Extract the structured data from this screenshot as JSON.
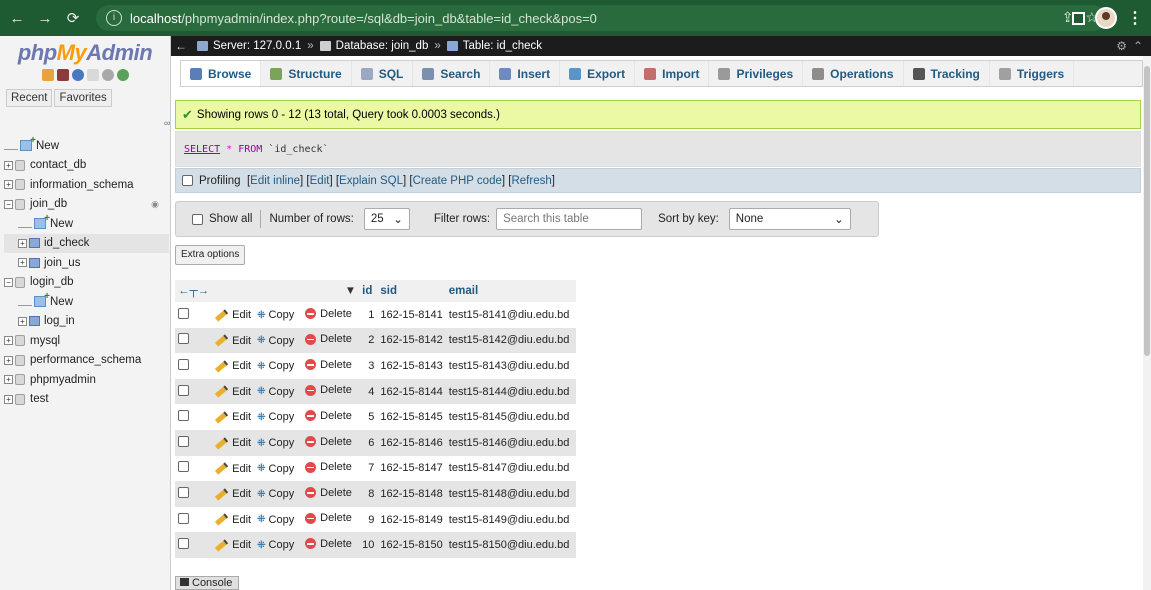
{
  "browser": {
    "url_host": "localhost",
    "url_path": "/phpmyadmin/index.php?route=/sql&db=join_db&table=id_check&pos=0"
  },
  "nav": {
    "logo_php": "php",
    "logo_my": "My",
    "logo_admin": "Admin",
    "tabs": [
      "Recent",
      "Favorites"
    ],
    "tree": [
      {
        "label": "New",
        "type": "new",
        "level": 0
      },
      {
        "label": "contact_db",
        "type": "db",
        "level": 0
      },
      {
        "label": "information_schema",
        "type": "db",
        "level": 0
      },
      {
        "label": "join_db",
        "type": "db",
        "level": 0,
        "expanded": true
      },
      {
        "label": "New",
        "type": "new",
        "level": 1
      },
      {
        "label": "id_check",
        "type": "table",
        "level": 1,
        "selected": true
      },
      {
        "label": "join_us",
        "type": "table",
        "level": 1
      },
      {
        "label": "login_db",
        "type": "db",
        "level": 0,
        "expanded": true
      },
      {
        "label": "New",
        "type": "new",
        "level": 1
      },
      {
        "label": "log_in",
        "type": "table",
        "level": 1
      },
      {
        "label": "mysql",
        "type": "db",
        "level": 0
      },
      {
        "label": "performance_schema",
        "type": "db",
        "level": 0
      },
      {
        "label": "phpmyadmin",
        "type": "db",
        "level": 0
      },
      {
        "label": "test",
        "type": "db",
        "level": 0
      }
    ]
  },
  "breadcrumb": {
    "server": "Server: 127.0.0.1",
    "database": "Database: join_db",
    "table": "Table: id_check"
  },
  "menu": [
    {
      "label": "Browse",
      "icon": "browse-icon",
      "color": "#5a7fb6",
      "active": true
    },
    {
      "label": "Structure",
      "icon": "structure-icon",
      "color": "#7aa45a"
    },
    {
      "label": "SQL",
      "icon": "sql-icon",
      "color": "#9aa9c1"
    },
    {
      "label": "Search",
      "icon": "search-icon",
      "color": "#7b8fb0"
    },
    {
      "label": "Insert",
      "icon": "insert-icon",
      "color": "#6f8ac0"
    },
    {
      "label": "Export",
      "icon": "export-icon",
      "color": "#5d94c8"
    },
    {
      "label": "Import",
      "icon": "import-icon",
      "color": "#c46d6d"
    },
    {
      "label": "Privileges",
      "icon": "privileges-icon",
      "color": "#9a9a9a"
    },
    {
      "label": "Operations",
      "icon": "operations-icon",
      "color": "#8d8d8d"
    },
    {
      "label": "Tracking",
      "icon": "tracking-icon",
      "color": "#555555"
    },
    {
      "label": "Triggers",
      "icon": "triggers-icon",
      "color": "#a0a0a0"
    }
  ],
  "message": {
    "success": "Showing rows 0 - 12 (13 total, Query took 0.0003 seconds.)"
  },
  "sql": {
    "select": "SELECT",
    "star": "*",
    "from": "FROM",
    "table": "`id_check`"
  },
  "profiling": {
    "label": "Profiling",
    "links": [
      "Edit inline",
      "Edit",
      "Explain SQL",
      "Create PHP code",
      "Refresh"
    ]
  },
  "controls": {
    "show_all": "Show all",
    "number_of_rows_label": "Number of rows:",
    "number_of_rows_value": "25",
    "filter_label": "Filter rows:",
    "filter_placeholder": "Search this table",
    "sort_label": "Sort by key:",
    "sort_value": "None",
    "extra_options": "Extra options"
  },
  "table": {
    "columns": [
      "id",
      "sid",
      "email"
    ],
    "row_actions": [
      "Edit",
      "Copy",
      "Delete"
    ],
    "rows": [
      {
        "id": "1",
        "sid": "162-15-8141",
        "email": "test15-8141@diu.edu.bd"
      },
      {
        "id": "2",
        "sid": "162-15-8142",
        "email": "test15-8142@diu.edu.bd"
      },
      {
        "id": "3",
        "sid": "162-15-8143",
        "email": "test15-8143@diu.edu.bd"
      },
      {
        "id": "4",
        "sid": "162-15-8144",
        "email": "test15-8144@diu.edu.bd"
      },
      {
        "id": "5",
        "sid": "162-15-8145",
        "email": "test15-8145@diu.edu.bd"
      },
      {
        "id": "6",
        "sid": "162-15-8146",
        "email": "test15-8146@diu.edu.bd"
      },
      {
        "id": "7",
        "sid": "162-15-8147",
        "email": "test15-8147@diu.edu.bd"
      },
      {
        "id": "8",
        "sid": "162-15-8148",
        "email": "test15-8148@diu.edu.bd"
      },
      {
        "id": "9",
        "sid": "162-15-8149",
        "email": "test15-8149@diu.edu.bd"
      },
      {
        "id": "10",
        "sid": "162-15-8150",
        "email": "test15-8150@diu.edu.bd"
      }
    ]
  },
  "console": "Console"
}
